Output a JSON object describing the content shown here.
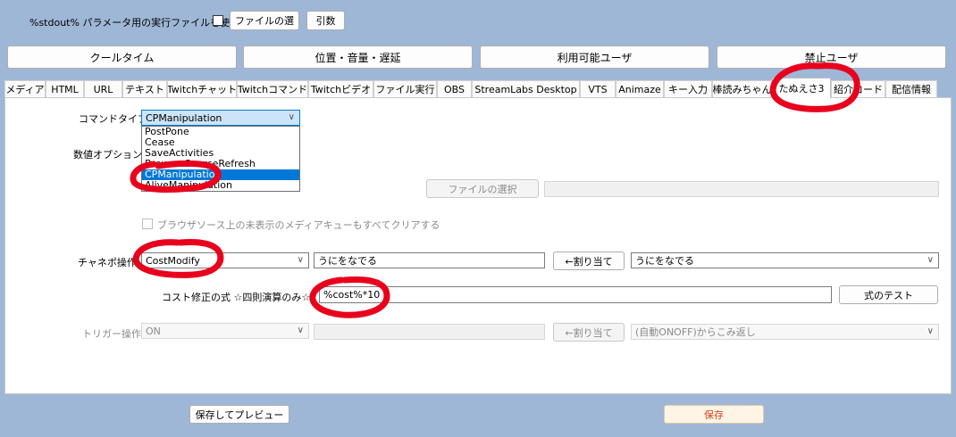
{
  "top_bar": {
    "stdout_label": "%stdout% パラメータ用の実行ファイルを使う",
    "file_select_label": "ファイルの選",
    "args_label": "引数"
  },
  "main_buttons": [
    "クールタイム",
    "位置・音量・遅延",
    "利用可能ユーザ",
    "禁止ユーザ"
  ],
  "tabs": [
    "メディア",
    "HTML",
    "URL",
    "テキスト",
    "Twitchチャット",
    "Twitchコマンド",
    "Twitchビデオ",
    "ファイル実行",
    "OBS",
    "StreamLabs Desktop",
    "VTS",
    "Animaze",
    "キー入力",
    "棒読みちゃん",
    "たぬえさ3",
    "紹介コード",
    "配信情報"
  ],
  "form": {
    "command_type_label": "コマンドタイプ",
    "command_type_value": "CPManipulation",
    "command_options": [
      "PostPone",
      "Cease",
      "SaveActivities",
      "BrowserSourceRefresh",
      "CPManipulation",
      "AliveManipulation"
    ],
    "numeric_option_label": "数値オプション",
    "file_select_label": "ファイルの選択",
    "clear_queue_label": "ブラウザソース上の未表示のメディアキューもすべてクリアする",
    "channel_point_label": "チャネポ操作",
    "channel_point_value": "CostModify",
    "channel_point_text": "うにをなでる",
    "assign_label": "←割り当て",
    "channel_point_target": "うにをなでる",
    "cost_formula_label": "コスト修正の式 ☆四則演算のみ☆",
    "cost_formula_value": "%cost%*10",
    "test_formula_label": "式のテスト",
    "trigger_label": "トリガー操作",
    "trigger_value": "ON",
    "trigger_assign_label": "←割り当て",
    "trigger_target": "(自動ONOFF)からこみ返し"
  },
  "bottom": {
    "save_preview_label": "保存してプレビュー",
    "save_label": "保存"
  },
  "colors": {
    "background": "#9fb7d6",
    "annotation": "#e8001c",
    "selection": "#0078d7",
    "save_button": "#fff5e6",
    "save_text": "#d4401a"
  }
}
